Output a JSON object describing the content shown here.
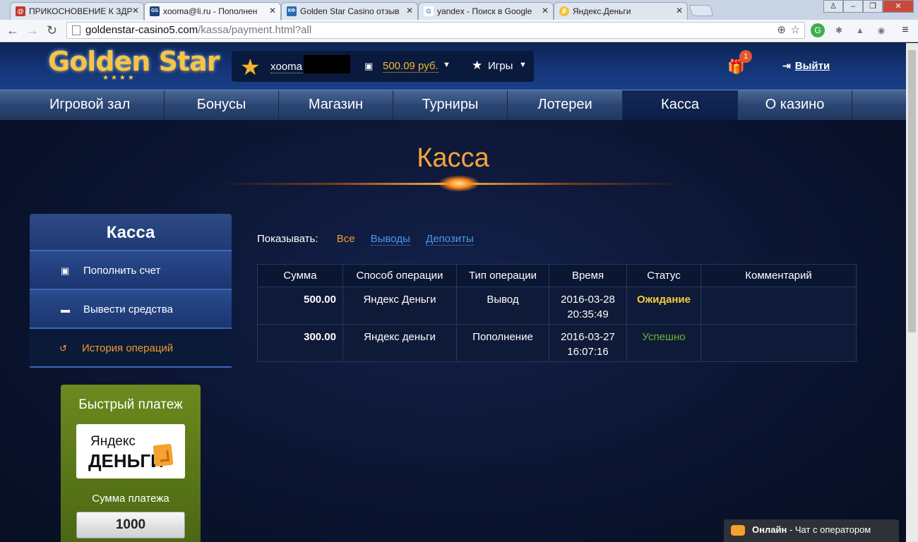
{
  "browser": {
    "tabs": [
      {
        "title": "ПРИКОСНОВЕНИЕ К ЗДР",
        "favicon": "@",
        "fav_color": "#c0392b"
      },
      {
        "title": "xooma@li.ru - Пополнен",
        "favicon": "GS",
        "fav_color": "#22427e"
      },
      {
        "title": "Golden Star Casino отзыв",
        "favicon": "КФ",
        "fav_color": "#2b6cb0"
      },
      {
        "title": "yandex - Поиск в Google",
        "favicon": "G",
        "fav_color": "#4285f4"
      },
      {
        "title": "Яндекс.Деньги",
        "favicon": "₽",
        "fav_color": "#f2c230"
      }
    ],
    "url_host": "goldenstar-casino5.com",
    "url_path": "/kassa/payment.html?all"
  },
  "header": {
    "logo_text": "Golden Star",
    "username": "xooma",
    "balance": "500.09 руб.",
    "games_label": "Игры",
    "gift_badge": "1",
    "logout_label": "Выйти"
  },
  "nav": [
    {
      "label": "Игровой зал",
      "active": false
    },
    {
      "label": "Бонусы",
      "active": false
    },
    {
      "label": "Магазин",
      "active": false
    },
    {
      "label": "Турниры",
      "active": false
    },
    {
      "label": "Лотереи",
      "active": false
    },
    {
      "label": "Касса",
      "active": true
    },
    {
      "label": "О казино",
      "active": false
    }
  ],
  "page": {
    "title": "Касса"
  },
  "sidebar": {
    "title": "Касса",
    "items": [
      {
        "label": "Пополнить счет",
        "icon": "money-icon",
        "active": false
      },
      {
        "label": "Вывести средства",
        "icon": "card-icon",
        "active": false
      },
      {
        "label": "История операций",
        "icon": "history-icon",
        "active": true
      }
    ]
  },
  "quickpay": {
    "title": "Быстрый платеж",
    "logo_line1": "Яндекс",
    "logo_line2": "ДЕНЬГИ",
    "amount_label": "Сумма платежа",
    "amount_value": "1000"
  },
  "filters": {
    "label": "Показывать:",
    "options": [
      {
        "label": "Все",
        "active": true
      },
      {
        "label": "Выводы",
        "active": false
      },
      {
        "label": "Депозиты",
        "active": false
      }
    ]
  },
  "table": {
    "headers": [
      "Сумма",
      "Способ операции",
      "Тип операции",
      "Время",
      "Статус",
      "Комментарий"
    ],
    "rows": [
      {
        "amount": "500.00",
        "method": "Яндекс Деньги",
        "type": "Вывод",
        "date": "2016-03-28",
        "time": "20:35:49",
        "status": "Ожидание",
        "status_kind": "wait",
        "comment": ""
      },
      {
        "amount": "300.00",
        "method": "Яндекс деньги",
        "type": "Пополнение",
        "date": "2016-03-27",
        "time": "16:07:16",
        "status": "Успешно",
        "status_kind": "ok",
        "comment": ""
      }
    ]
  },
  "chat": {
    "status": "Онлайн",
    "text": " - Чат с оператором"
  },
  "colors": {
    "accent": "#f49a2d",
    "link": "#4a99e8",
    "wait": "#f7cf3a",
    "ok": "#6cb82e",
    "quickpay": "#5a7a18"
  }
}
